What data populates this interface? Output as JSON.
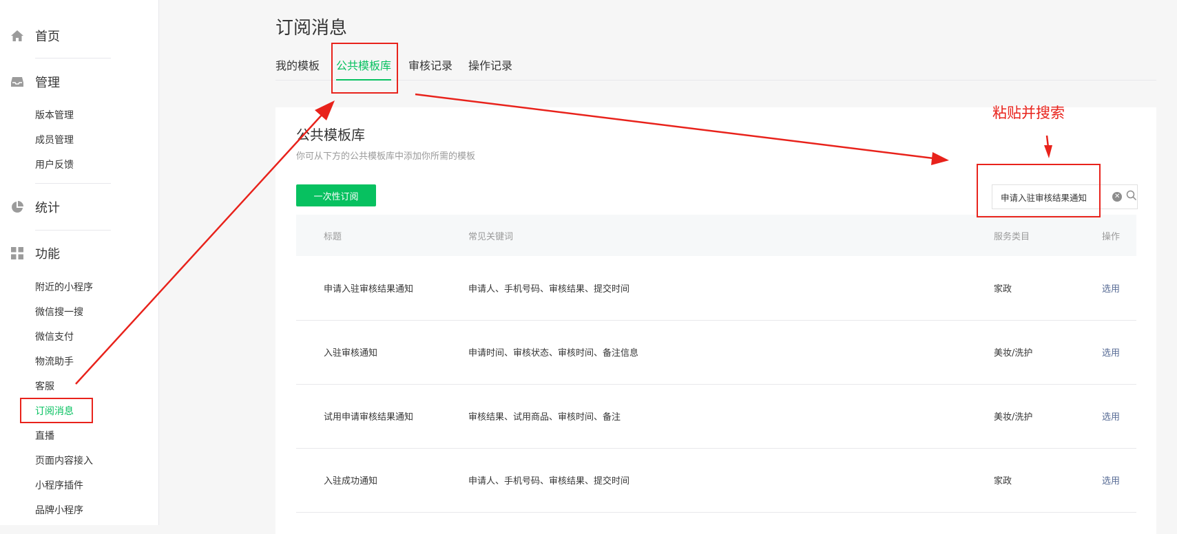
{
  "sidebar": {
    "home": {
      "label": "首页",
      "icon": "home-icon"
    },
    "manage": {
      "label": "管理",
      "icon": "inbox-icon",
      "items": [
        "版本管理",
        "成员管理",
        "用户反馈"
      ]
    },
    "stats": {
      "label": "统计",
      "icon": "pie-chart-icon"
    },
    "features": {
      "label": "功能",
      "icon": "grid-icon",
      "items": [
        "附近的小程序",
        "微信搜一搜",
        "微信支付",
        "物流助手",
        "客服",
        "订阅消息",
        "直播",
        "页面内容接入",
        "小程序插件",
        "品牌小程序"
      ],
      "active_item": "订阅消息"
    }
  },
  "page_title": "订阅消息",
  "tabs": [
    {
      "label": "我的模板",
      "active": false
    },
    {
      "label": "公共模板库",
      "active": true
    },
    {
      "label": "审核记录",
      "active": false
    },
    {
      "label": "操作记录",
      "active": false
    }
  ],
  "panel": {
    "title": "公共模板库",
    "description": "你可从下方的公共模板库中添加你所需的模板",
    "primary_button": "一次性订阅",
    "search": {
      "value": "申请入驻审核结果通知",
      "placeholder": ""
    },
    "table": {
      "headers": [
        "标题",
        "常见关键词",
        "服务类目",
        "操作"
      ],
      "rows": [
        {
          "title": "申请入驻审核结果通知",
          "keywords": "申请人、手机号码、审核结果、提交时间",
          "category": "家政",
          "action": "选用"
        },
        {
          "title": "入驻审核通知",
          "keywords": "申请时间、审核状态、审核时间、备注信息",
          "category": "美妆/洗护",
          "action": "选用"
        },
        {
          "title": "试用申请审核结果通知",
          "keywords": "审核结果、试用商品、审核时间、备注",
          "category": "美妆/洗护",
          "action": "选用"
        },
        {
          "title": "入驻成功通知",
          "keywords": "申请人、手机号码、审核结果、提交时间",
          "category": "家政",
          "action": "选用"
        }
      ]
    }
  },
  "annotation": {
    "text": "粘贴并搜索"
  },
  "colors": {
    "accent": "#07c160",
    "link": "#576b95",
    "annotation": "#e8221b"
  }
}
